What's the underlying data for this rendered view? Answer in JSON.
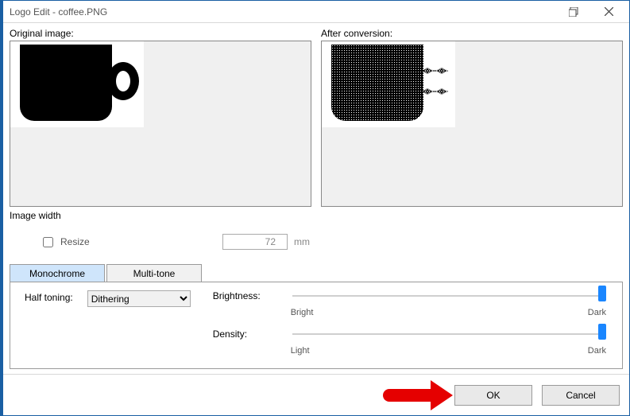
{
  "window": {
    "title": "Logo Edit - coffee.PNG"
  },
  "labels": {
    "original": "Original image:",
    "after": "After conversion:",
    "image_width": "Image width",
    "resize": "Resize",
    "unit": "mm",
    "half_toning": "Half toning:",
    "brightness": "Brightness:",
    "density": "Density:"
  },
  "width_value": "72",
  "tabs": {
    "mono": "Monochrome",
    "multi": "Multi-tone"
  },
  "half_toning_option": "Dithering",
  "slider_ticks": {
    "brightness": {
      "left": "Bright",
      "right": "Dark"
    },
    "density": {
      "left": "Light",
      "right": "Dark"
    }
  },
  "buttons": {
    "ok": "OK",
    "cancel": "Cancel"
  }
}
